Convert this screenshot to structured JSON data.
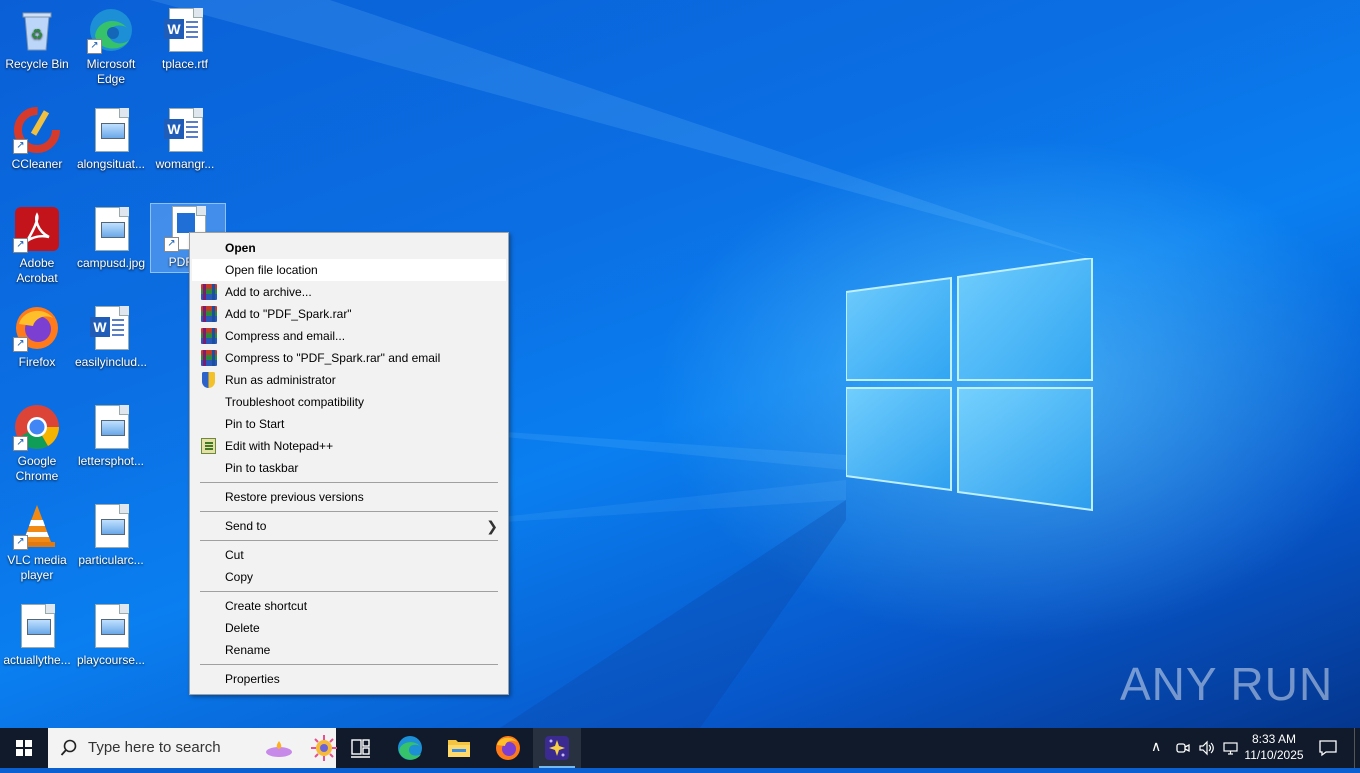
{
  "desktop": {
    "icons": [
      {
        "label": "Recycle Bin",
        "kind": "recycle-bin"
      },
      {
        "label": "Microsoft Edge",
        "kind": "edge"
      },
      {
        "label": "tplace.rtf",
        "kind": "word"
      },
      {
        "label": "CCleaner",
        "kind": "ccleaner"
      },
      {
        "label": "alongsituat...",
        "kind": "image"
      },
      {
        "label": "womangr...",
        "kind": "word"
      },
      {
        "label": "Adobe Acrobat",
        "kind": "acrobat"
      },
      {
        "label": "campusd.jpg",
        "kind": "image"
      },
      {
        "label": "PDF_S",
        "kind": "pdfspark",
        "selected": true
      },
      {
        "label": "Firefox",
        "kind": "firefox"
      },
      {
        "label": "easilyinclud...",
        "kind": "word"
      },
      {
        "label": "Google Chrome",
        "kind": "chrome"
      },
      {
        "label": "lettersphot...",
        "kind": "image"
      },
      {
        "label": "VLC media player",
        "kind": "vlc"
      },
      {
        "label": "particularc...",
        "kind": "image"
      },
      {
        "label": "actuallythe...",
        "kind": "image"
      },
      {
        "label": "playcourse...",
        "kind": "image"
      }
    ]
  },
  "context_menu": {
    "items": [
      {
        "label": "Open",
        "bold": true
      },
      {
        "label": "Open file location",
        "hover": true
      },
      {
        "label": "Add to archive...",
        "icon": "winrar-icon"
      },
      {
        "label": "Add to \"PDF_Spark.rar\"",
        "icon": "winrar-icon"
      },
      {
        "label": "Compress and email...",
        "icon": "winrar-icon"
      },
      {
        "label": "Compress to \"PDF_Spark.rar\" and email",
        "icon": "winrar-icon"
      },
      {
        "label": "Run as administrator",
        "icon": "uac-shield-icon"
      },
      {
        "label": "Troubleshoot compatibility"
      },
      {
        "label": "Pin to Start"
      },
      {
        "label": "Edit with Notepad++",
        "icon": "notepadpp-icon"
      },
      {
        "label": "Pin to taskbar"
      },
      {
        "label": "Restore previous versions"
      },
      {
        "label": "Send to",
        "submenu": true
      },
      {
        "label": "Cut"
      },
      {
        "label": "Copy"
      },
      {
        "label": "Create shortcut"
      },
      {
        "label": "Delete"
      },
      {
        "label": "Rename"
      },
      {
        "label": "Properties"
      }
    ]
  },
  "taskbar": {
    "search_placeholder": "Type here to search",
    "pinned": [
      "task-view-icon",
      "edge-icon",
      "file-explorer-icon",
      "firefox-icon",
      "pdf-spark-icon"
    ],
    "clock_time": "8:33 AM",
    "clock_date": "11/10/2025"
  },
  "watermark": "ANY RUN",
  "colors": {
    "menu_bg": "#f2f2f2",
    "menu_hover": "#ffffff",
    "taskbar": "#101a2a",
    "accent": "#0a6fe3"
  }
}
